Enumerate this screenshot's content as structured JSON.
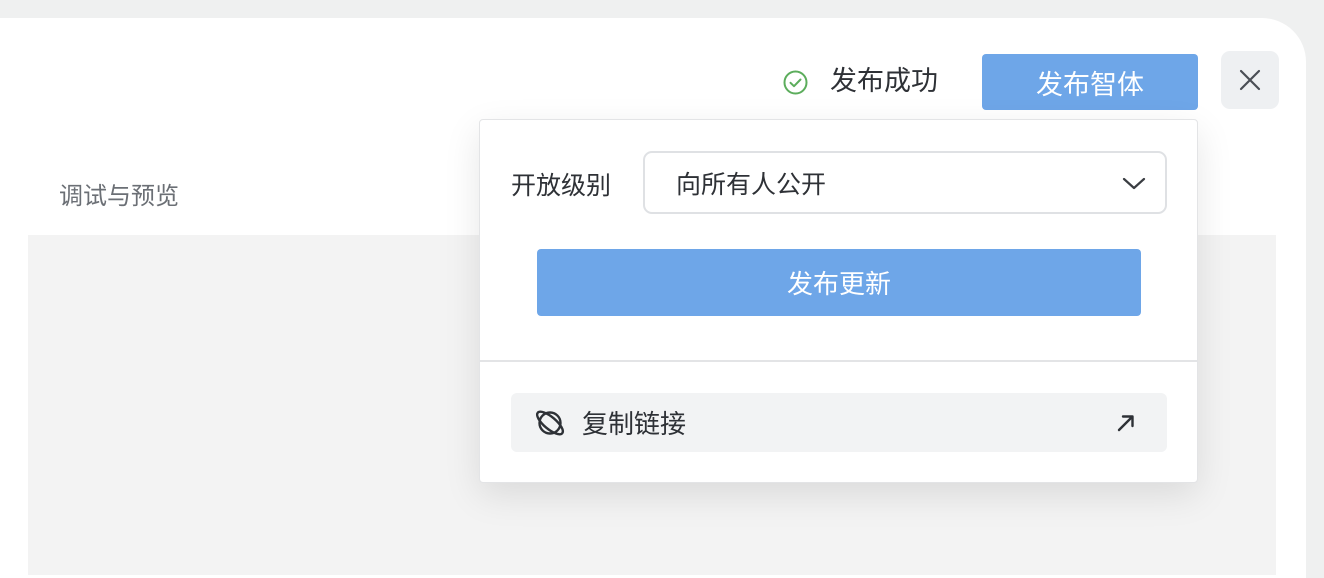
{
  "preview": {
    "title": "调试与预览"
  },
  "status": {
    "text": "发布成功",
    "icon": "check-circle-icon",
    "color": "#5cad5c"
  },
  "header": {
    "publish_label": "发布智体",
    "close_icon": "close-icon"
  },
  "colors": {
    "accent": "#6ea6e8",
    "panel_bg": "#f3f3f3",
    "text": "#2e3136"
  },
  "popover": {
    "level_label": "开放级别",
    "level_value": "向所有人公开",
    "update_label": "发布更新",
    "copy_label": "复制链接",
    "copy_icon": "planet-icon",
    "open_icon": "arrow-up-right-icon"
  }
}
